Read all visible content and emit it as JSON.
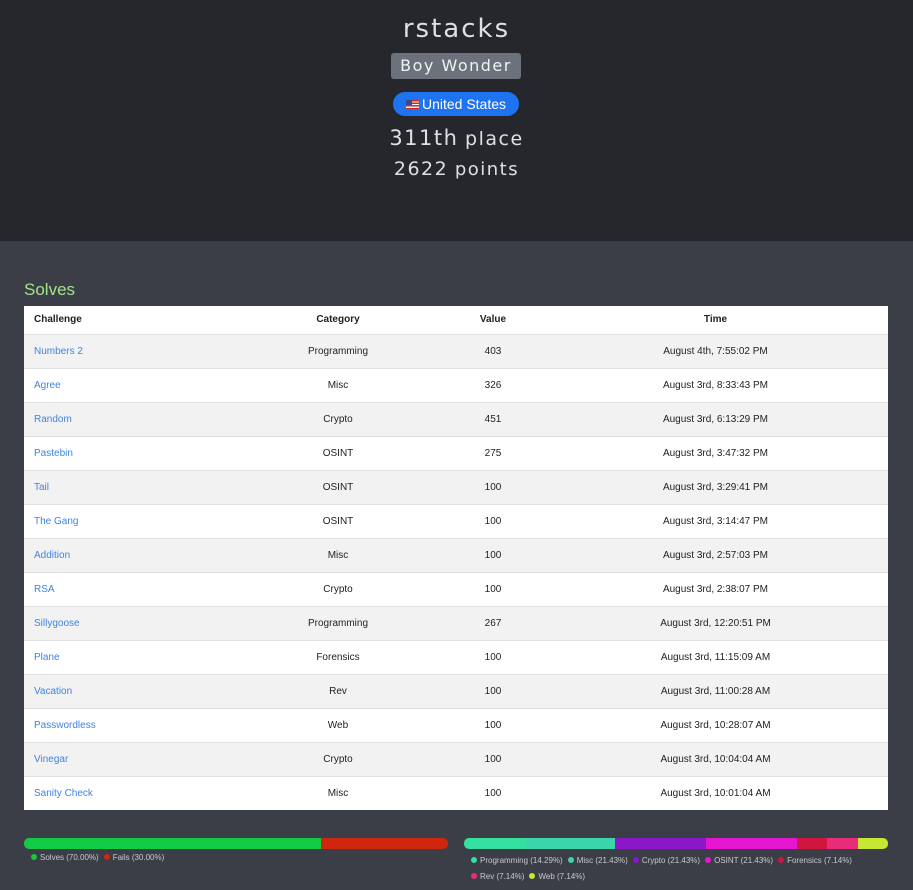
{
  "team": {
    "name": "rstacks",
    "affiliation": "Boy Wonder",
    "country": "United States",
    "place_number": "311th",
    "place_label": "place",
    "points_number": "2622",
    "points_label": "points"
  },
  "solves": {
    "title": "Solves",
    "columns": [
      "Challenge",
      "Category",
      "Value",
      "Time"
    ],
    "rows": [
      {
        "challenge": "Numbers 2",
        "category": "Programming",
        "value": "403",
        "time": "August 4th, 7:55:02 PM"
      },
      {
        "challenge": "Agree",
        "category": "Misc",
        "value": "326",
        "time": "August 3rd, 8:33:43 PM"
      },
      {
        "challenge": "Random",
        "category": "Crypto",
        "value": "451",
        "time": "August 3rd, 6:13:29 PM"
      },
      {
        "challenge": "Pastebin",
        "category": "OSINT",
        "value": "275",
        "time": "August 3rd, 3:47:32 PM"
      },
      {
        "challenge": "Tail",
        "category": "OSINT",
        "value": "100",
        "time": "August 3rd, 3:29:41 PM"
      },
      {
        "challenge": "The Gang",
        "category": "OSINT",
        "value": "100",
        "time": "August 3rd, 3:14:47 PM"
      },
      {
        "challenge": "Addition",
        "category": "Misc",
        "value": "100",
        "time": "August 3rd, 2:57:03 PM"
      },
      {
        "challenge": "RSA",
        "category": "Crypto",
        "value": "100",
        "time": "August 3rd, 2:38:07 PM"
      },
      {
        "challenge": "Sillygoose",
        "category": "Programming",
        "value": "267",
        "time": "August 3rd, 12:20:51 PM"
      },
      {
        "challenge": "Plane",
        "category": "Forensics",
        "value": "100",
        "time": "August 3rd, 11:15:09 AM"
      },
      {
        "challenge": "Vacation",
        "category": "Rev",
        "value": "100",
        "time": "August 3rd, 11:00:28 AM"
      },
      {
        "challenge": "Passwordless",
        "category": "Web",
        "value": "100",
        "time": "August 3rd, 10:28:07 AM"
      },
      {
        "challenge": "Vinegar",
        "category": "Crypto",
        "value": "100",
        "time": "August 3rd, 10:04:04 AM"
      },
      {
        "challenge": "Sanity Check",
        "category": "Misc",
        "value": "100",
        "time": "August 3rd, 10:01:04 AM"
      }
    ]
  },
  "solve_fail_bar": [
    {
      "label": "Solves (70.00%)",
      "percent": 70.0,
      "color": "#11cc44"
    },
    {
      "label": "Fails (30.00%)",
      "percent": 30.0,
      "color": "#d0260f"
    }
  ],
  "category_bar": [
    {
      "label": "Programming (14.29%)",
      "percent": 14.29,
      "color": "#33e0a0"
    },
    {
      "label": "Misc (21.43%)",
      "percent": 21.43,
      "color": "#3ad6aa"
    },
    {
      "label": "Crypto (21.43%)",
      "percent": 21.43,
      "color": "#8a17c8"
    },
    {
      "label": "OSINT (21.43%)",
      "percent": 21.43,
      "color": "#e516d0"
    },
    {
      "label": "Forensics (7.14%)",
      "percent": 7.14,
      "color": "#d0163f"
    },
    {
      "label": "Rev (7.14%)",
      "percent": 7.14,
      "color": "#e82c7a"
    },
    {
      "label": "Web (7.14%)",
      "percent": 7.14,
      "color": "#c6e833"
    }
  ]
}
